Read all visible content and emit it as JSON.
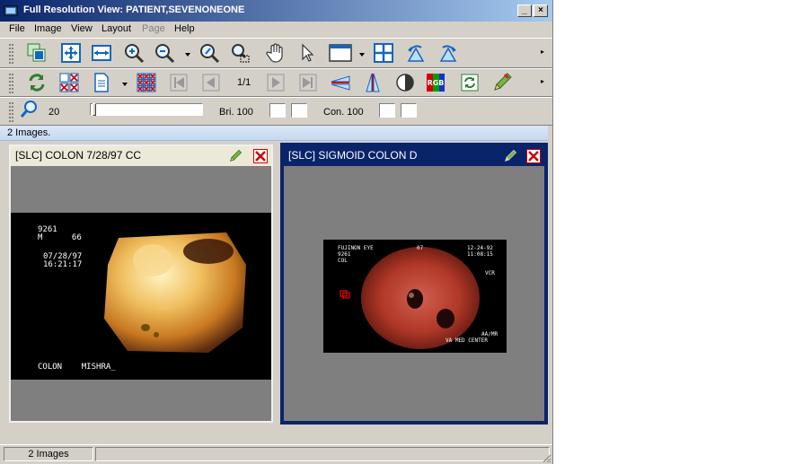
{
  "window": {
    "title": "Full Resolution View: PATIENT,SEVENONEONE",
    "minimize_glyph": "_",
    "maximize_glyph": "□",
    "close_glyph": "×"
  },
  "menu": {
    "items": [
      "File",
      "Image",
      "View",
      "Layout",
      "Page",
      "Help"
    ],
    "disabled": [
      "Page"
    ]
  },
  "toolbar2": {
    "page_indicator": "1/1"
  },
  "toolbar3": {
    "zoom_value": "20",
    "brightness_label": "Bri. 100",
    "contrast_label": "Con. 100"
  },
  "infobar": {
    "text": "2 Images."
  },
  "panels": [
    {
      "title": "[SLC] COLON  7/28/97 CC",
      "overlay": {
        "id": "9261",
        "sex_age": "M      66",
        "date": "07/28/97",
        "time": "16:21:17",
        "bottom": "COLON    MISHRA_"
      }
    },
    {
      "title": "[SLC] SIGMOID COLON D",
      "overlay": {
        "scope": "FUJINON EYE",
        "num": "07",
        "id": "9261",
        "site": "COL",
        "date": "12-24-92",
        "time": "11:08:15",
        "source": "VCR",
        "initials": "AA/MR",
        "center": "VA MED CENTER"
      }
    }
  ],
  "statusbar": {
    "text": "2 Images"
  },
  "colors": {
    "titlebar_start": "#0a246a",
    "titlebar_end": "#a6caf0",
    "selected_panel_border": "#0a246a",
    "close_x": "#cc0000"
  }
}
